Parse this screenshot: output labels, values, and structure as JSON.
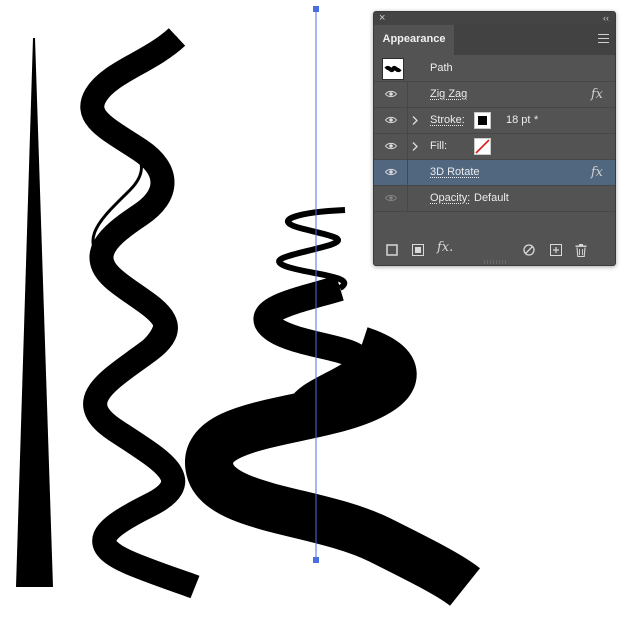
{
  "panel": {
    "title": "Appearance",
    "close_glyph": "×",
    "collapse_glyph": "‹‹",
    "rows": [
      {
        "label": "Path",
        "kind": "header",
        "icon": "path-thumbnail"
      },
      {
        "label": "Zig Zag",
        "kind": "effect",
        "has_fx": true
      },
      {
        "label": "Stroke:",
        "kind": "stroke",
        "value": "18 pt",
        "value_suffix": "*",
        "swatch_color": "#000000"
      },
      {
        "label": "Fill:",
        "kind": "fill",
        "swatch": "none"
      },
      {
        "label": "3D Rotate",
        "kind": "effect",
        "has_fx": true,
        "selected": true
      },
      {
        "label": "Opacity:",
        "kind": "opacity",
        "value": "Default"
      }
    ],
    "fx_glyph": "fx",
    "footer_fx_glyph": "fx.",
    "footer_icons": [
      "add-stroke-icon",
      "add-fill-icon",
      "add-effect-icon",
      "clear-appearance-icon",
      "duplicate-item-icon",
      "delete-item-icon"
    ],
    "selected_row_color": "#51667f",
    "panel_bg": "#535353"
  },
  "artboard": {
    "guide_color": "#4a6fe3",
    "shape_fill": "#000000"
  }
}
